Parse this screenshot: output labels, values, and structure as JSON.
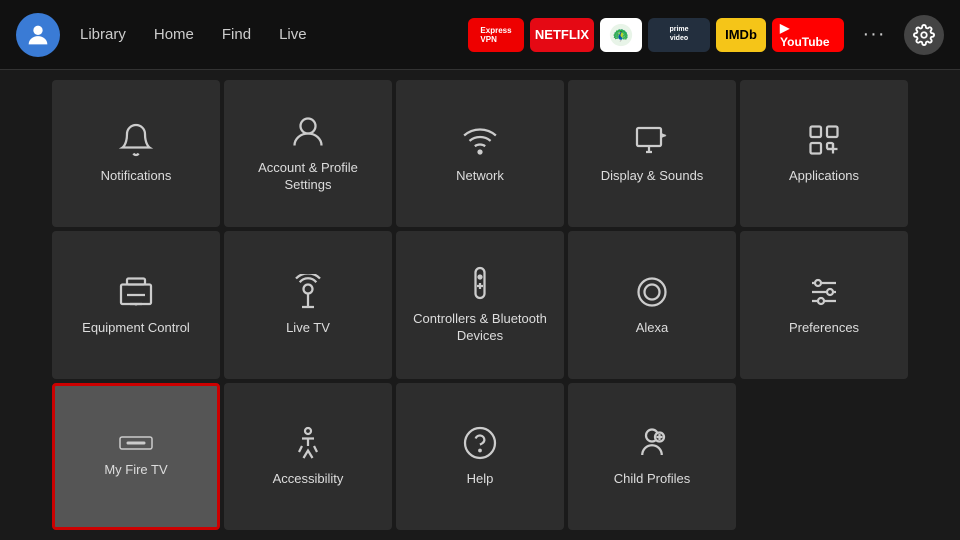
{
  "nav": {
    "links": [
      "Library",
      "Home",
      "Find",
      "Live"
    ],
    "apps": [
      {
        "name": "ExpressVPN",
        "class": "app-expressvpn",
        "label": "Express VPN"
      },
      {
        "name": "Netflix",
        "class": "app-netflix",
        "label": "NETFLIX"
      },
      {
        "name": "Peacock",
        "class": "app-peacock",
        "label": "🦚"
      },
      {
        "name": "Prime Video",
        "class": "app-prime",
        "label": "prime video"
      },
      {
        "name": "IMDb TV",
        "class": "app-imdb",
        "label": "IMDb"
      },
      {
        "name": "YouTube",
        "class": "app-youtube",
        "label": "▶ YouTube"
      }
    ],
    "more_label": "···",
    "settings_label": "⚙"
  },
  "grid": {
    "cells": [
      {
        "id": "notifications",
        "label": "Notifications",
        "icon": "bell"
      },
      {
        "id": "account-profile",
        "label": "Account & Profile Settings",
        "icon": "person"
      },
      {
        "id": "network",
        "label": "Network",
        "icon": "wifi"
      },
      {
        "id": "display-sounds",
        "label": "Display & Sounds",
        "icon": "display"
      },
      {
        "id": "applications",
        "label": "Applications",
        "icon": "apps"
      },
      {
        "id": "equipment-control",
        "label": "Equipment Control",
        "icon": "tv"
      },
      {
        "id": "live-tv",
        "label": "Live TV",
        "icon": "antenna"
      },
      {
        "id": "controllers-bluetooth",
        "label": "Controllers & Bluetooth Devices",
        "icon": "remote"
      },
      {
        "id": "alexa",
        "label": "Alexa",
        "icon": "alexa"
      },
      {
        "id": "preferences",
        "label": "Preferences",
        "icon": "sliders"
      },
      {
        "id": "my-fire-tv",
        "label": "My Fire TV",
        "icon": "firetv",
        "selected": true
      },
      {
        "id": "accessibility",
        "label": "Accessibility",
        "icon": "accessibility"
      },
      {
        "id": "help",
        "label": "Help",
        "icon": "help"
      },
      {
        "id": "child-profiles",
        "label": "Child Profiles",
        "icon": "child"
      },
      {
        "id": "empty",
        "label": "",
        "icon": ""
      }
    ]
  }
}
